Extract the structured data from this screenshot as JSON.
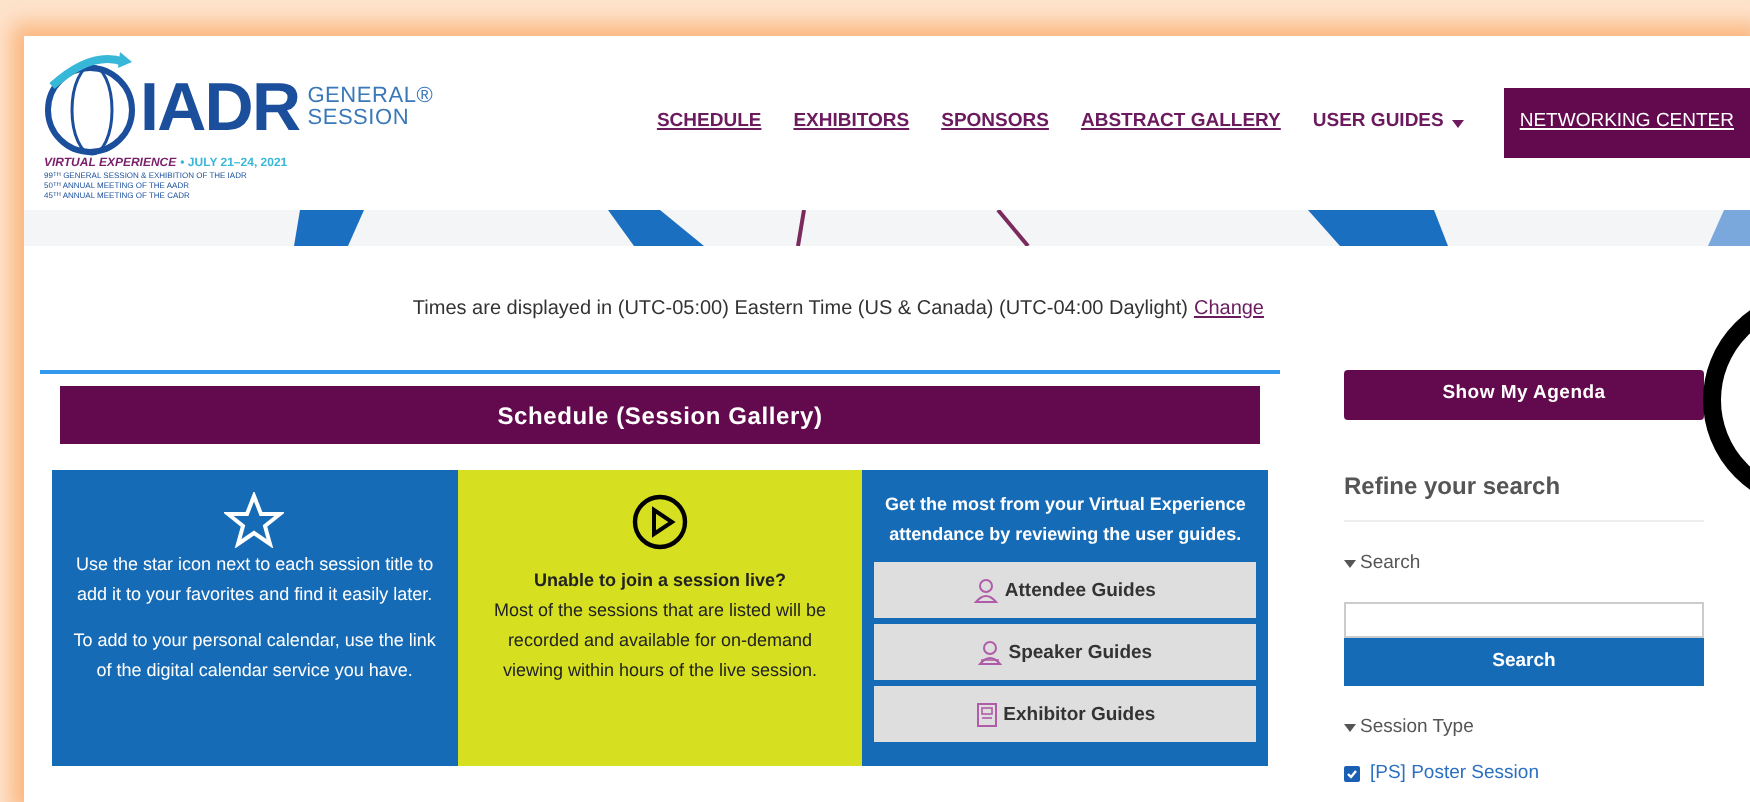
{
  "header": {
    "logo": {
      "wordmark": "IADR",
      "title_lines": [
        "GENERAL®",
        "SESSION"
      ],
      "event": "VIRTUAL EXPERIENCE",
      "dates": "• JULY 21–24, 2021",
      "subtitle_lines": [
        "99$^{TH}$ GENERAL SESSION & EXHIBITION OF THE IADR",
        "50$^{TH}$ ANNUAL MEETING OF THE AADR",
        "45$^{TH}$ ANNUAL MEETING OF THE CADR"
      ]
    },
    "nav": [
      {
        "label": "SCHEDULE",
        "kind": "link"
      },
      {
        "label": "EXHIBITORS",
        "kind": "link"
      },
      {
        "label": "SPONSORS",
        "kind": "link"
      },
      {
        "label": "ABSTRACT GALLERY",
        "kind": "link"
      },
      {
        "label": "USER GUIDES",
        "kind": "dropdown"
      },
      {
        "label": "NETWORKING CENTER",
        "kind": "button"
      }
    ]
  },
  "timezone": {
    "text": "Times are displayed in (UTC-05:00) Eastern Time (US & Canada) (UTC-04:00 Daylight)",
    "link": "Change"
  },
  "main": {
    "title": "Schedule (Session Gallery)",
    "panels": [
      {
        "kind": "star",
        "paragraphs": [
          "Use the star icon next to each session title to add it to your favorites and find it easily later.",
          "To add to your personal calendar, use the link of the digital calendar service you have."
        ]
      },
      {
        "kind": "play",
        "heading": "Unable to join a session live?",
        "paragraphs": [
          "Most of the sessions that are listed will be recorded and available for on-demand viewing within hours of the live session."
        ]
      },
      {
        "kind": "guides",
        "heading": "Get the most from your Virtual Experience attendance by reviewing the user guides.",
        "buttons": [
          {
            "label": "Attendee Guides",
            "kind": "attendee"
          },
          {
            "label": "Speaker Guides",
            "kind": "speaker"
          },
          {
            "label": "Exhibitor Guides",
            "kind": "exhibitor"
          }
        ]
      }
    ]
  },
  "sidebar": {
    "agenda_button": "Show My Agenda",
    "heading": "Refine your search",
    "sections": [
      {
        "title": "Search",
        "expanded": true,
        "kind": "search",
        "button": "Search"
      },
      {
        "title": "Session Type",
        "expanded": true,
        "kind": "options",
        "options": [
          {
            "label": "[PS] Poster Session",
            "checked": true
          }
        ]
      }
    ]
  }
}
